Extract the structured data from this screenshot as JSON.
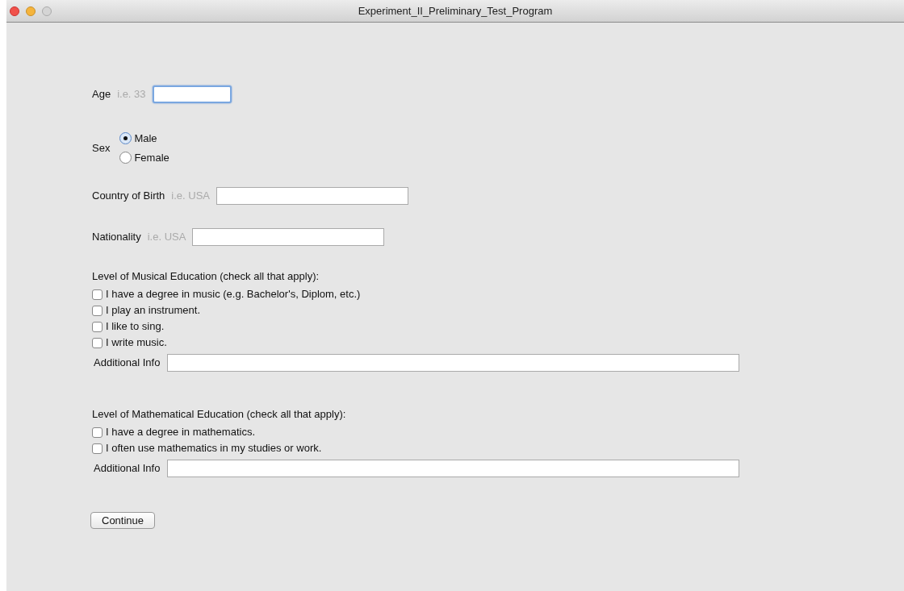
{
  "window": {
    "title": "Experiment_II_Preliminary_Test_Program"
  },
  "form": [
    {
      "kind": "text_field",
      "label": "Age",
      "hint": "i.e. 33",
      "focused": true
    },
    {
      "kind": "radio_group",
      "label": "Sex",
      "options": [
        {
          "label": "Male",
          "selected": true
        },
        {
          "label": "Female",
          "selected": false
        }
      ]
    },
    {
      "kind": "text_field",
      "label": "Country of Birth",
      "hint": "i.e. USA",
      "focused": false
    },
    {
      "kind": "text_field",
      "label": "Nationality",
      "hint": "i.e. USA",
      "focused": false
    },
    {
      "kind": "checkbox_group",
      "heading": "Level of Musical Education (check all that apply):",
      "options": [
        {
          "label": "I have a degree in music (e.g. Bachelor's, Diplom, etc.)",
          "checked": false
        },
        {
          "label": "I play an instrument.",
          "checked": false
        },
        {
          "label": "I like to sing.",
          "checked": false
        },
        {
          "label": "I write music.",
          "checked": false
        }
      ],
      "info_label": "Additional Info"
    },
    {
      "kind": "checkbox_group",
      "heading": "Level of Mathematical Education (check all that apply):",
      "options": [
        {
          "label": "I have a degree in mathematics.",
          "checked": false
        },
        {
          "label": "I often use mathematics in my studies or work.",
          "checked": false
        }
      ],
      "info_label": "Additional Info"
    },
    {
      "kind": "button",
      "label": "Continue"
    }
  ]
}
